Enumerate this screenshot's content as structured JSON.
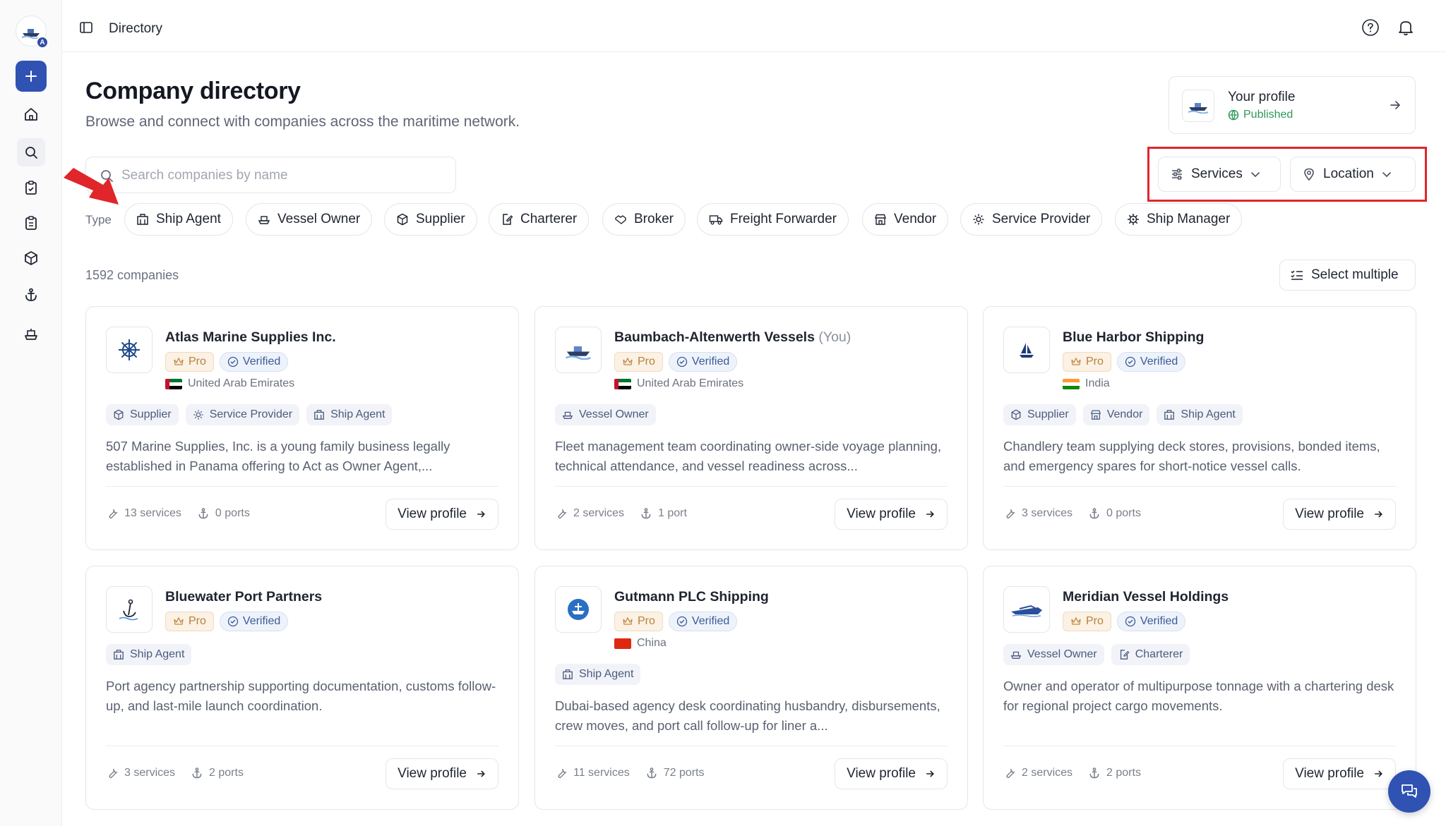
{
  "breadcrumb": "Directory",
  "header": {
    "title": "Company directory",
    "subtitle": "Browse and connect with companies across the maritime network."
  },
  "profile": {
    "title": "Your profile",
    "status": "Published"
  },
  "search": {
    "placeholder": "Search companies by name",
    "value": ""
  },
  "filters": {
    "services": "Services",
    "location": "Location"
  },
  "type_label": "Type",
  "types": [
    {
      "label": "Ship Agent",
      "icon": "building-icon"
    },
    {
      "label": "Vessel Owner",
      "icon": "ship-icon"
    },
    {
      "label": "Supplier",
      "icon": "package-icon"
    },
    {
      "label": "Charterer",
      "icon": "clipboard-edit-icon"
    },
    {
      "label": "Broker",
      "icon": "handshake-icon"
    },
    {
      "label": "Freight Forwarder",
      "icon": "truck-icon"
    },
    {
      "label": "Vendor",
      "icon": "store-icon"
    },
    {
      "label": "Service Provider",
      "icon": "gear-icon"
    },
    {
      "label": "Ship Manager",
      "icon": "helm-icon"
    }
  ],
  "count": "1592 companies",
  "select_multiple": "Select multiple",
  "badges": {
    "pro": "Pro",
    "verified": "Verified"
  },
  "view_profile": "View profile",
  "you_label": "(You)",
  "companies": [
    {
      "name": "Atlas Marine Supplies Inc.",
      "country": "United Arab Emirates",
      "tags": [
        "Supplier",
        "Service Provider",
        "Ship Agent"
      ],
      "description": "507 Marine Supplies, Inc. is a young family business legally established in Panama offering to Act as Owner Agent,...",
      "services": "13 services",
      "ports": "0 ports"
    },
    {
      "name": "Baumbach-Altenwerth Vessels",
      "country": "United Arab Emirates",
      "tags": [
        "Vessel Owner"
      ],
      "description": "Fleet management team coordinating owner-side voyage planning, technical attendance, and vessel readiness across...",
      "services": "2 services",
      "ports": "1 port"
    },
    {
      "name": "Blue Harbor Shipping",
      "country": "India",
      "tags": [
        "Supplier",
        "Vendor",
        "Ship Agent"
      ],
      "description": "Chandlery team supplying deck stores, provisions, bonded items, and emergency spares for short-notice vessel calls.",
      "services": "3 services",
      "ports": "0 ports"
    },
    {
      "name": "Bluewater Port Partners",
      "country": "",
      "tags": [
        "Ship Agent"
      ],
      "description": "Port agency partnership supporting documentation, customs follow-up, and last-mile launch coordination.",
      "services": "3 services",
      "ports": "2 ports"
    },
    {
      "name": "Gutmann PLC Shipping",
      "country": "China",
      "tags": [
        "Ship Agent"
      ],
      "description": "Dubai-based agency desk coordinating husbandry, disbursements, crew moves, and port call follow-up for liner a...",
      "services": "11 services",
      "ports": "72 ports"
    },
    {
      "name": "Meridian Vessel Holdings",
      "country": "",
      "tags": [
        "Vessel Owner",
        "Charterer"
      ],
      "description": "Owner and operator of multipurpose tonnage with a chartering desk for regional project cargo movements.",
      "services": "2 services",
      "ports": "2 ports"
    }
  ],
  "colors": {
    "accent": "#2f52b3",
    "highlight_box": "#e0262b",
    "published": "#2f9a5a"
  }
}
